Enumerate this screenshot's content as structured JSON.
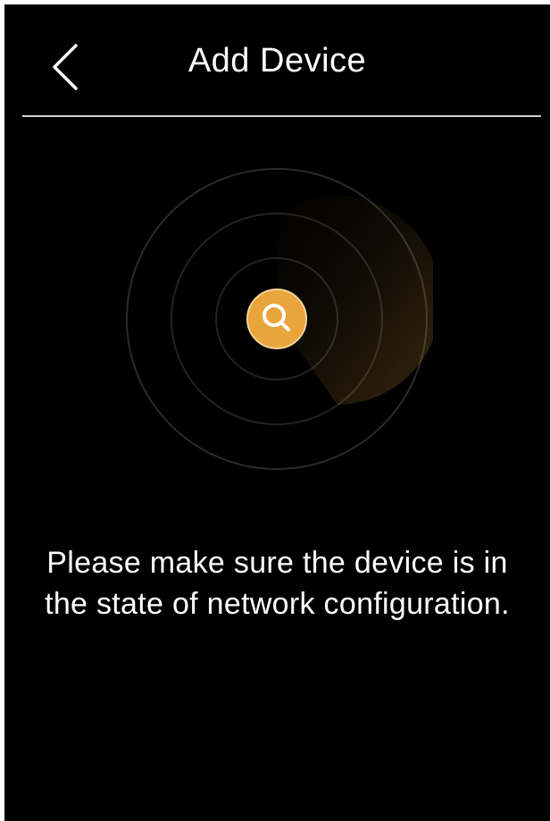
{
  "header": {
    "title": "Add Device",
    "back_icon": "chevron-left-icon"
  },
  "scan": {
    "icon": "search-icon",
    "accent_color": "#E9A43C",
    "state": "scanning"
  },
  "message": {
    "text": "Please make sure the device is in the state of network configuration."
  },
  "colors": {
    "background": "#000000",
    "text": "#FFFFFF",
    "divider": "#CFCFCF",
    "ring": "#2A2A2A"
  }
}
